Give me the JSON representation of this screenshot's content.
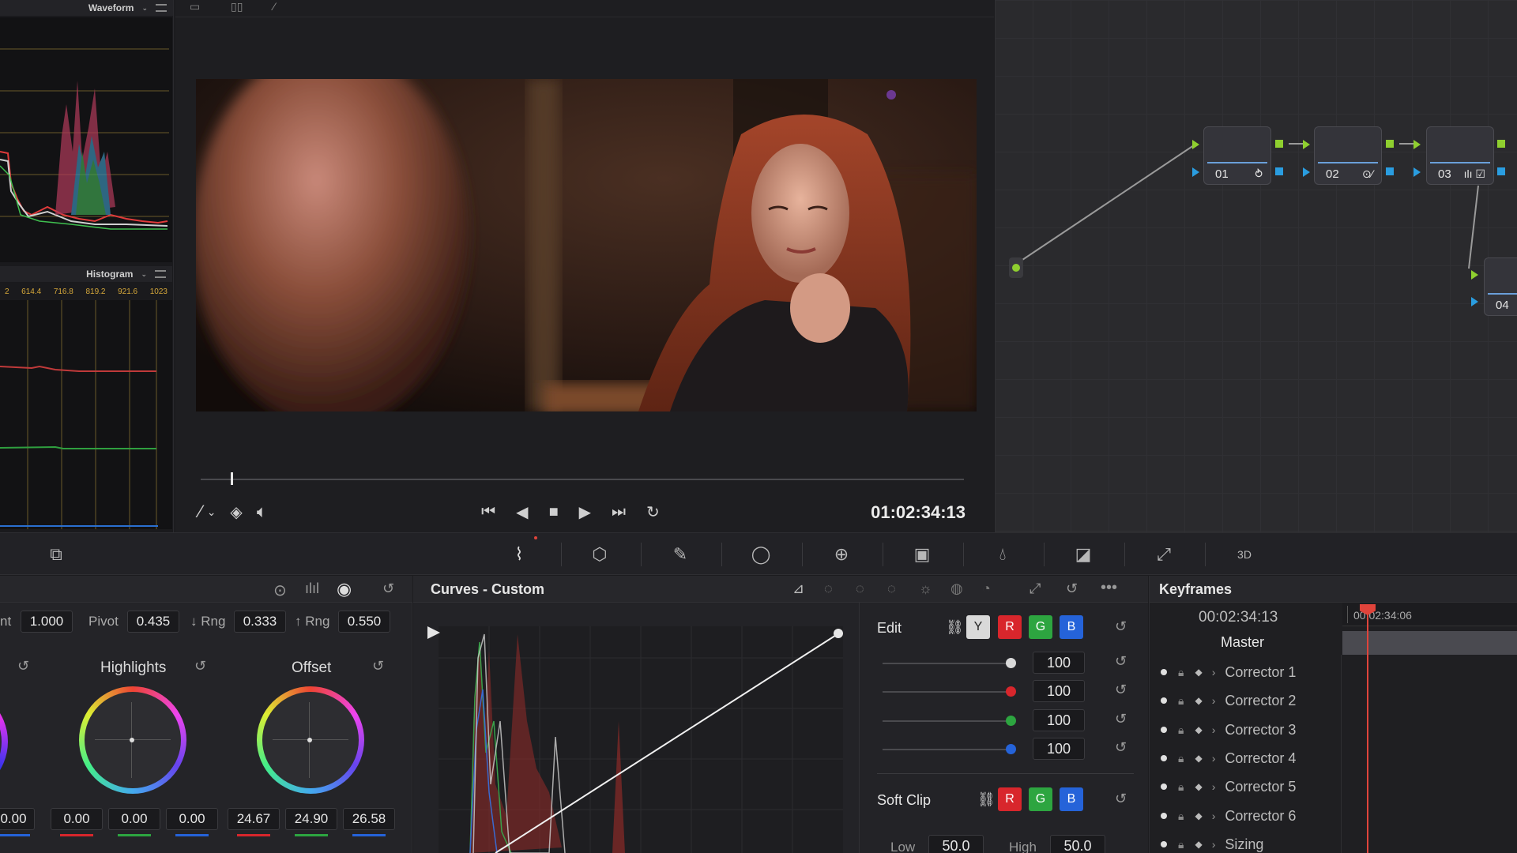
{
  "scopes": {
    "waveform_title": "Waveform",
    "histogram_title": "Histogram",
    "histogram_ticks": [
      "2",
      "614.4",
      "716.8",
      "819.2",
      "921.6",
      "1023"
    ]
  },
  "viewer": {
    "timecode": "01:02:34:13",
    "playhead_fraction": 0.04
  },
  "node_graph": {
    "nodes": [
      {
        "label": "01",
        "icon": "⥁"
      },
      {
        "label": "02",
        "icon": "⊙⁄"
      },
      {
        "label": "03",
        "icon": "ılı ☑"
      },
      {
        "label": "04",
        "icon": ""
      }
    ]
  },
  "color_wheels": {
    "params": {
      "contrast_label": "nt",
      "contrast_value": "1.000",
      "pivot_label": "Pivot",
      "pivot_value": "0.435",
      "low_range_label": "↓ Rng",
      "low_range_value": "0.333",
      "high_range_label": "↑ Rng",
      "high_range_value": "0.550"
    },
    "highlights": {
      "title": "Highlights",
      "values": [
        "0.00",
        "0.00",
        "0.00"
      ]
    },
    "offset": {
      "title": "Offset",
      "values": [
        "24.67",
        "24.90",
        "26.58"
      ]
    },
    "partial_left_value": "0.00"
  },
  "curves": {
    "title": "Curves - Custom",
    "edit_label": "Edit",
    "channels": [
      "Y",
      "R",
      "G",
      "B"
    ],
    "intensity": [
      {
        "channel": "Y",
        "value": "100",
        "color": "#d9d9d9"
      },
      {
        "channel": "R",
        "value": "100",
        "color": "#d8262c"
      },
      {
        "channel": "G",
        "value": "100",
        "color": "#2da540"
      },
      {
        "channel": "B",
        "value": "100",
        "color": "#2563d9"
      }
    ],
    "soft_clip_label": "Soft Clip",
    "soft_clip_channels": [
      "R",
      "G",
      "B"
    ],
    "low_label": "Low",
    "low_value": "50.0",
    "high_label": "High",
    "high_value": "50.0"
  },
  "keyframes": {
    "title": "Keyframes",
    "timecode": "00:02:34:13",
    "ruler_timecode": "00:02:34:06",
    "master_label": "Master",
    "tracks": [
      "Corrector 1",
      "Corrector 2",
      "Corrector 3",
      "Corrector 4",
      "Corrector 5",
      "Corrector 6",
      "Sizing"
    ]
  },
  "colors": {
    "accent_red": "#e0443b",
    "node_green": "#8fcf2f",
    "node_blue": "#2a9de0"
  }
}
